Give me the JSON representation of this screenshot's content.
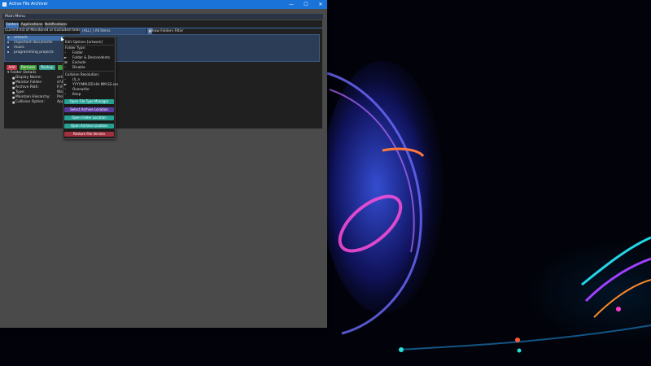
{
  "window": {
    "title": "Active File Archiver"
  },
  "titlebar_buttons": {
    "minimize": "—",
    "maximize": "☐",
    "close": "✕"
  },
  "menu": {
    "title": "Main Menu"
  },
  "tabs": [
    {
      "label": "Folders"
    },
    {
      "label": "Applications"
    },
    {
      "label": "Notifications"
    }
  ],
  "folders": {
    "list_title": "Current list of Monitored or Excluded folders:",
    "filter_value": "(ALL) | All Items",
    "filter_btn": "▼",
    "show_filter_label": "Show Folders Filter",
    "items": [
      {
        "label": "artwork"
      },
      {
        "label": "important documents"
      },
      {
        "label": "music"
      },
      {
        "label": "programming projects"
      }
    ],
    "buttons": {
      "add": "Add",
      "remove": "Remove",
      "backup": "Backup",
      "more": "..."
    }
  },
  "details": {
    "header": "Folder Details",
    "rows": [
      {
        "label": "Display Name:",
        "value": "artw"
      },
      {
        "label": "Monitor Folder:",
        "value": "d:\\Fi"
      },
      {
        "label": "Archive Path:",
        "value": "F:\\R"
      },
      {
        "label": "Type:",
        "value": "Wat"
      },
      {
        "label": "Maintain Hierarchy:",
        "value": "Pres"
      },
      {
        "label": "Collision Option:",
        "value": "App"
      }
    ]
  },
  "popup": {
    "title": "Edit Options [artwork]",
    "folder_type_label": "Folder Type:",
    "folder_types": [
      "Folder",
      "Folder & Descendents",
      "Exclude",
      "Disable"
    ],
    "folder_type_marks": [
      "◦",
      "►",
      "⊠",
      "◦"
    ],
    "collision_label": "Collision Resolution:",
    "collision_options": [
      "(l)_n",
      "YYYY.MM.DD.HH.MM.SS.sss",
      "Overwrite",
      "Keep"
    ],
    "collision_marks": [
      "◦",
      "►",
      "◦",
      "◦"
    ],
    "actions": [
      {
        "label": "Open File Type Manager",
        "color": "#27a094"
      },
      {
        "label": "Select Archive Location",
        "color": "#5b3aa0"
      },
      {
        "label": "Open Folder Location",
        "color": "#27a094"
      },
      {
        "label": "Open Archive Location",
        "color": "#27a094"
      },
      {
        "label": "Restore File Version",
        "color": "#a12f3e"
      }
    ]
  },
  "colors": {
    "titlebar": "#1a73d9",
    "tab_active": "#3c6fb0",
    "add": "#c0394b",
    "remove": "#3f9c3c",
    "backup": "#2f9a8a",
    "panel": "#202020"
  },
  "icons": {
    "cursor": "arrow-cursor-icon",
    "app": "app-icon",
    "expand": "triangle-down-icon"
  }
}
